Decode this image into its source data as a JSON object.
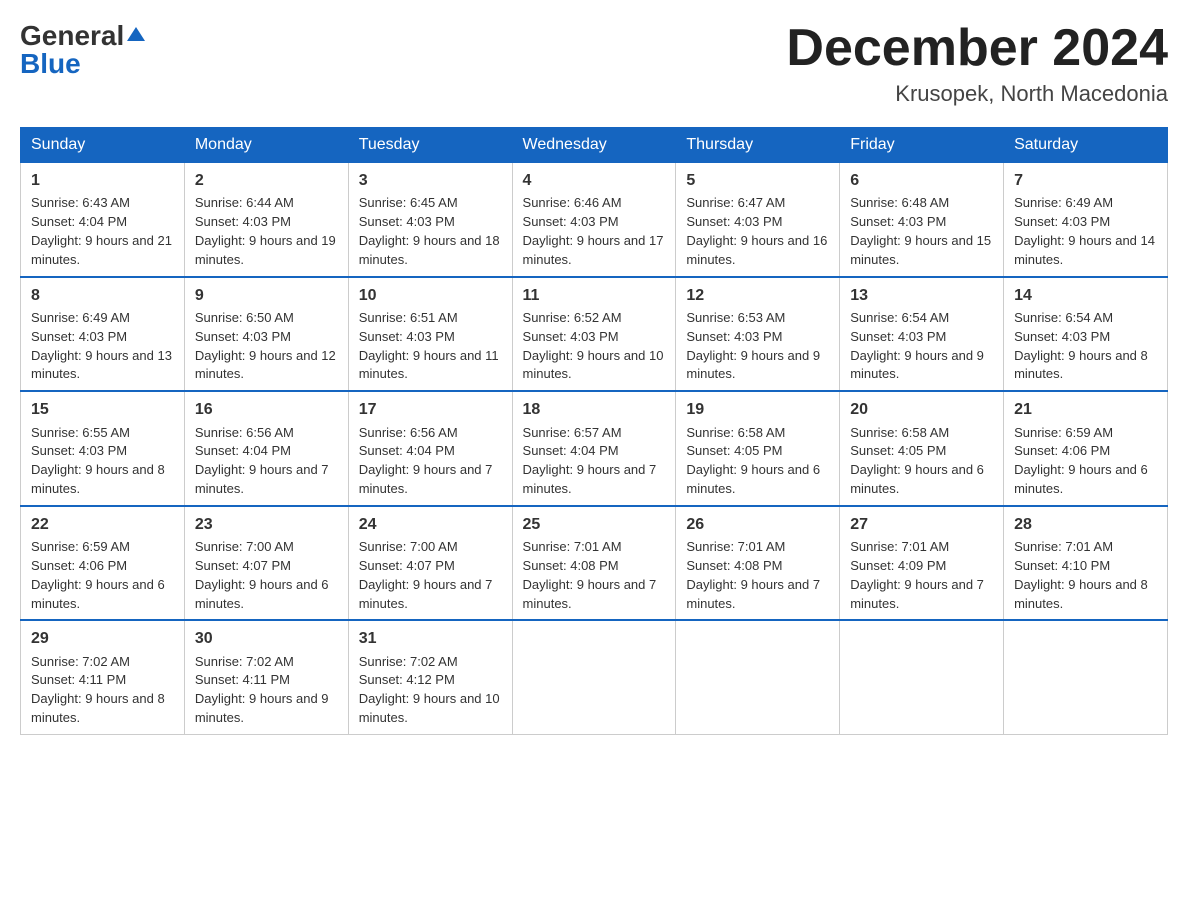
{
  "header": {
    "logo_general": "General",
    "logo_blue": "Blue",
    "month_title": "December 2024",
    "location": "Krusopek, North Macedonia"
  },
  "days_of_week": [
    "Sunday",
    "Monday",
    "Tuesday",
    "Wednesday",
    "Thursday",
    "Friday",
    "Saturday"
  ],
  "weeks": [
    [
      {
        "day": "1",
        "sunrise": "6:43 AM",
        "sunset": "4:04 PM",
        "daylight": "9 hours and 21 minutes."
      },
      {
        "day": "2",
        "sunrise": "6:44 AM",
        "sunset": "4:03 PM",
        "daylight": "9 hours and 19 minutes."
      },
      {
        "day": "3",
        "sunrise": "6:45 AM",
        "sunset": "4:03 PM",
        "daylight": "9 hours and 18 minutes."
      },
      {
        "day": "4",
        "sunrise": "6:46 AM",
        "sunset": "4:03 PM",
        "daylight": "9 hours and 17 minutes."
      },
      {
        "day": "5",
        "sunrise": "6:47 AM",
        "sunset": "4:03 PM",
        "daylight": "9 hours and 16 minutes."
      },
      {
        "day": "6",
        "sunrise": "6:48 AM",
        "sunset": "4:03 PM",
        "daylight": "9 hours and 15 minutes."
      },
      {
        "day": "7",
        "sunrise": "6:49 AM",
        "sunset": "4:03 PM",
        "daylight": "9 hours and 14 minutes."
      }
    ],
    [
      {
        "day": "8",
        "sunrise": "6:49 AM",
        "sunset": "4:03 PM",
        "daylight": "9 hours and 13 minutes."
      },
      {
        "day": "9",
        "sunrise": "6:50 AM",
        "sunset": "4:03 PM",
        "daylight": "9 hours and 12 minutes."
      },
      {
        "day": "10",
        "sunrise": "6:51 AM",
        "sunset": "4:03 PM",
        "daylight": "9 hours and 11 minutes."
      },
      {
        "day": "11",
        "sunrise": "6:52 AM",
        "sunset": "4:03 PM",
        "daylight": "9 hours and 10 minutes."
      },
      {
        "day": "12",
        "sunrise": "6:53 AM",
        "sunset": "4:03 PM",
        "daylight": "9 hours and 9 minutes."
      },
      {
        "day": "13",
        "sunrise": "6:54 AM",
        "sunset": "4:03 PM",
        "daylight": "9 hours and 9 minutes."
      },
      {
        "day": "14",
        "sunrise": "6:54 AM",
        "sunset": "4:03 PM",
        "daylight": "9 hours and 8 minutes."
      }
    ],
    [
      {
        "day": "15",
        "sunrise": "6:55 AM",
        "sunset": "4:03 PM",
        "daylight": "9 hours and 8 minutes."
      },
      {
        "day": "16",
        "sunrise": "6:56 AM",
        "sunset": "4:04 PM",
        "daylight": "9 hours and 7 minutes."
      },
      {
        "day": "17",
        "sunrise": "6:56 AM",
        "sunset": "4:04 PM",
        "daylight": "9 hours and 7 minutes."
      },
      {
        "day": "18",
        "sunrise": "6:57 AM",
        "sunset": "4:04 PM",
        "daylight": "9 hours and 7 minutes."
      },
      {
        "day": "19",
        "sunrise": "6:58 AM",
        "sunset": "4:05 PM",
        "daylight": "9 hours and 6 minutes."
      },
      {
        "day": "20",
        "sunrise": "6:58 AM",
        "sunset": "4:05 PM",
        "daylight": "9 hours and 6 minutes."
      },
      {
        "day": "21",
        "sunrise": "6:59 AM",
        "sunset": "4:06 PM",
        "daylight": "9 hours and 6 minutes."
      }
    ],
    [
      {
        "day": "22",
        "sunrise": "6:59 AM",
        "sunset": "4:06 PM",
        "daylight": "9 hours and 6 minutes."
      },
      {
        "day": "23",
        "sunrise": "7:00 AM",
        "sunset": "4:07 PM",
        "daylight": "9 hours and 6 minutes."
      },
      {
        "day": "24",
        "sunrise": "7:00 AM",
        "sunset": "4:07 PM",
        "daylight": "9 hours and 7 minutes."
      },
      {
        "day": "25",
        "sunrise": "7:01 AM",
        "sunset": "4:08 PM",
        "daylight": "9 hours and 7 minutes."
      },
      {
        "day": "26",
        "sunrise": "7:01 AM",
        "sunset": "4:08 PM",
        "daylight": "9 hours and 7 minutes."
      },
      {
        "day": "27",
        "sunrise": "7:01 AM",
        "sunset": "4:09 PM",
        "daylight": "9 hours and 7 minutes."
      },
      {
        "day": "28",
        "sunrise": "7:01 AM",
        "sunset": "4:10 PM",
        "daylight": "9 hours and 8 minutes."
      }
    ],
    [
      {
        "day": "29",
        "sunrise": "7:02 AM",
        "sunset": "4:11 PM",
        "daylight": "9 hours and 8 minutes."
      },
      {
        "day": "30",
        "sunrise": "7:02 AM",
        "sunset": "4:11 PM",
        "daylight": "9 hours and 9 minutes."
      },
      {
        "day": "31",
        "sunrise": "7:02 AM",
        "sunset": "4:12 PM",
        "daylight": "9 hours and 10 minutes."
      },
      null,
      null,
      null,
      null
    ]
  ]
}
